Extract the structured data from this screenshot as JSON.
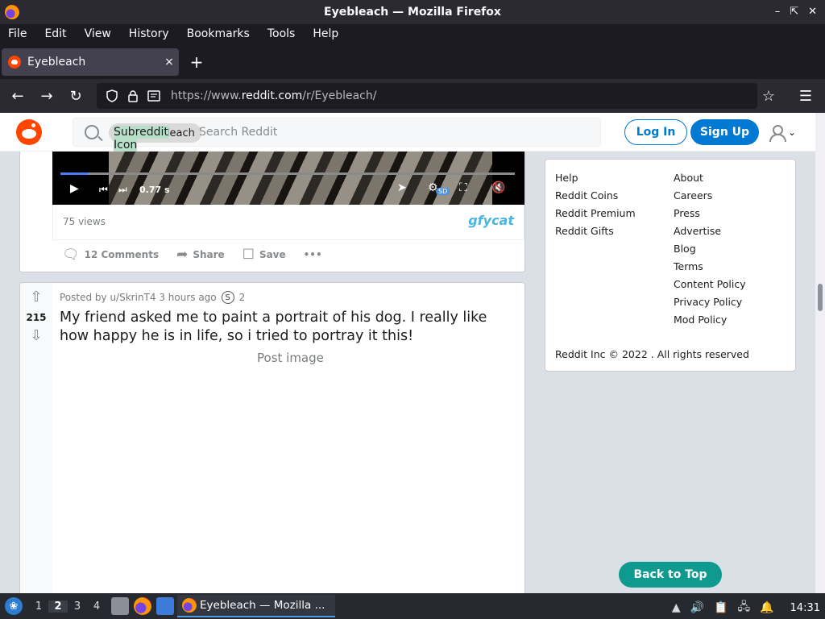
{
  "window": {
    "title": "Eyebleach — Mozilla Firefox"
  },
  "menu": [
    "File",
    "Edit",
    "View",
    "History",
    "Bookmarks",
    "Tools",
    "Help"
  ],
  "tab": {
    "label": "Eyebleach",
    "close": "×",
    "new": "+"
  },
  "nav": {
    "url_prefix": "https://www.",
    "url_host": "reddit.com",
    "url_path": "/r/Eyebleach/"
  },
  "reddit_header": {
    "chip_label": "r/Eyebleach",
    "chip_alt": "Subreddit Icon",
    "search_placeholder": "Search Reddit",
    "login": "Log In",
    "signup": "Sign Up"
  },
  "video_post": {
    "time": "0.77 s",
    "sd": "SD",
    "views": "75 views",
    "source": "gfycat",
    "progress_fraction": 0.06,
    "actions": {
      "comments": "12 Comments",
      "share": "Share",
      "save": "Save",
      "more": "•••"
    }
  },
  "post": {
    "votes": "215",
    "meta": "Posted by u/SkrinT4 3 hours ago",
    "award_count": "2",
    "title": "My friend asked me to paint a portrait of his dog. I really like how happy he is in life, so i tried to portray it this!",
    "image_alt": "Post image"
  },
  "sidebar": {
    "col1": [
      "Help",
      "Reddit Coins",
      "Reddit Premium",
      "Reddit Gifts"
    ],
    "col2": [
      "About",
      "Careers",
      "Press",
      "Advertise",
      "Blog",
      "Terms",
      "Content Policy",
      "Privacy Policy",
      "Mod Policy"
    ],
    "copyright": "Reddit Inc © 2022 . All rights reserved"
  },
  "back_to_top": "Back to Top",
  "taskbar": {
    "workspaces": [
      "1",
      "2",
      "3",
      "4"
    ],
    "active_workspace": "2",
    "task_label": "Eyebleach — Mozilla ...",
    "clock": "14:31"
  },
  "colors": {
    "reddit_orange": "#ff4500",
    "reddit_blue": "#0079d3",
    "back_to_top": "#0e9a8f"
  }
}
